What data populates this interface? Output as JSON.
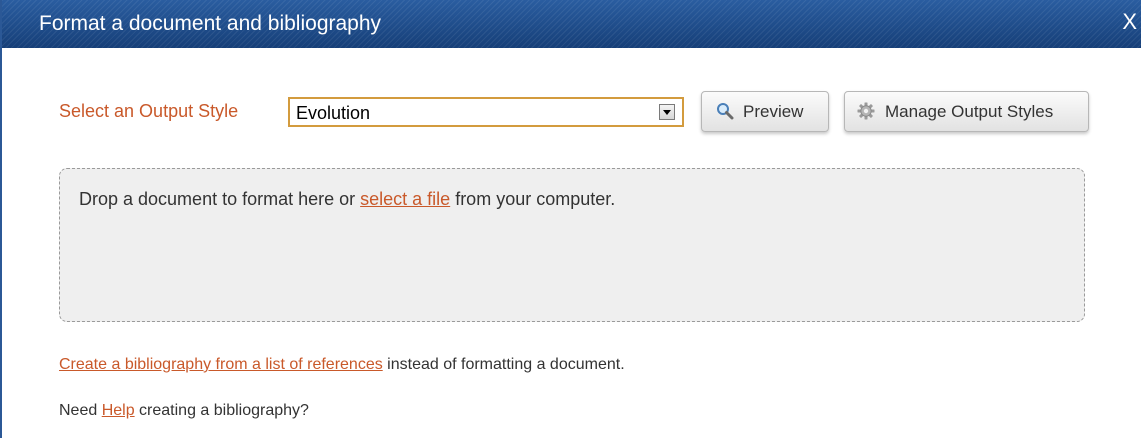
{
  "dialog": {
    "title": "Format a document and bibliography",
    "close_label": "X"
  },
  "output_style": {
    "label": "Select an Output Style",
    "selected": "Evolution"
  },
  "buttons": {
    "preview": "Preview",
    "manage": "Manage Output Styles"
  },
  "dropzone": {
    "text_before": "Drop a document to format here or ",
    "link": "select a file",
    "text_after": " from your computer."
  },
  "bibliography": {
    "link": "Create a bibliography from a list of references",
    "text_after": " instead of formatting a document."
  },
  "help": {
    "text_before": "Need ",
    "link": "Help",
    "text_after": " creating a bibliography?"
  },
  "colors": {
    "titlebar": "#1f4f8e",
    "link": "#c9592a",
    "label": "#c9592a",
    "select_border": "#d39b3e"
  },
  "icons": {
    "preview": "magnifier-icon",
    "manage": "gear-icon",
    "select": "chevron-down-icon"
  }
}
